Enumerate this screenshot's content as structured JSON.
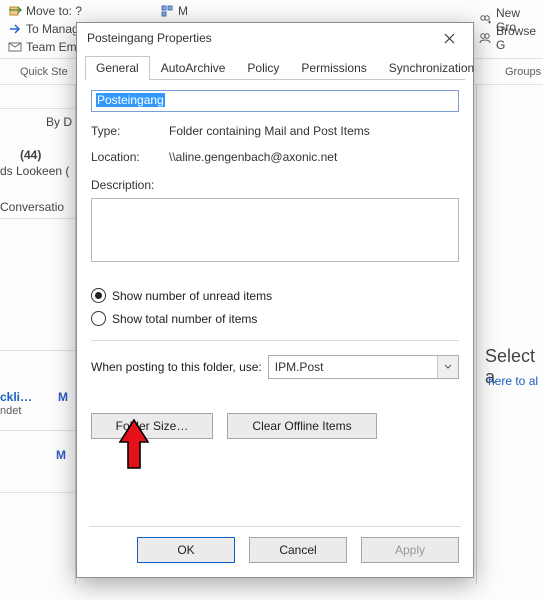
{
  "ribbon": {
    "move_to": "Move to: ?",
    "manage": "To Manage",
    "team_email": "Team Ema",
    "quick_steps": "Quick Ste",
    "new_group": "New Gro",
    "browse_group": "Browse G",
    "move_label": "M",
    "groups_label": "Groups"
  },
  "side": {
    "by": "By D",
    "count": "(44)",
    "lookeen": "ds Lookeen (",
    "conversation": "Conversatio",
    "ckli": "ckli…",
    "ndet": "ndet",
    "m1": "M",
    "m2": "M"
  },
  "hint": {
    "select_a": "Select a",
    "here_to": "here to al"
  },
  "dialog": {
    "title": "Posteingang Properties",
    "tabs": {
      "general": "General",
      "autoarchive": "AutoArchive",
      "policy": "Policy",
      "permissions": "Permissions",
      "synchronization": "Synchronization"
    },
    "folder_name": "Posteingang",
    "type_label": "Type:",
    "type_value": "Folder containing Mail and Post Items",
    "location_label": "Location:",
    "location_value": "\\\\aline.gengenbach@axonic.net",
    "description_label": "Description:",
    "radio_unread": "Show number of unread items",
    "radio_total": "Show total number of items",
    "posting_label": "When posting to this folder, use:",
    "posting_value": "IPM.Post",
    "folder_size": "Folder Size…",
    "clear_offline": "Clear Offline Items",
    "ok": "OK",
    "cancel": "Cancel",
    "apply": "Apply"
  }
}
